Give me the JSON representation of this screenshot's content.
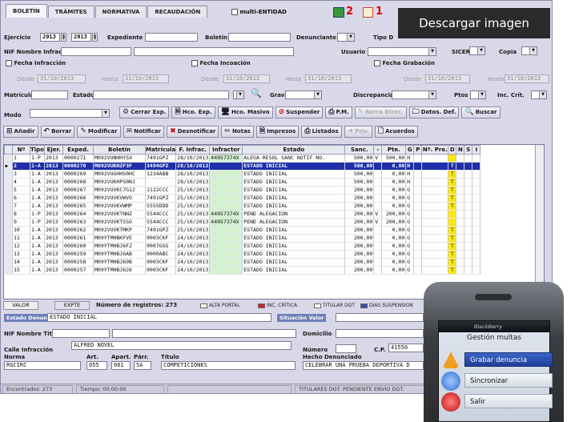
{
  "tabs": [
    "BOLETÍN",
    "TRÁMITES",
    "NORMATIVA",
    "RECAUDACIÓN"
  ],
  "multi_entidad": "multi-ENTIDAD",
  "badge_counts": [
    "2",
    "1"
  ],
  "overlay_text": "Descargar imagen",
  "filters": {
    "ejercicio_label": "Ejercicio",
    "ejercicio_from": "2013",
    "ejercicio_to": "2013",
    "expediente_label": "Expediente",
    "boletin_label": "Boletín",
    "denunciante_label": "Denunciante",
    "tipo_label": "Tipo D",
    "nif_label": "NIF Nombre Infractor",
    "usuario_label": "Usuario",
    "sicer_label": "SICER",
    "copia_label": "Copia",
    "fecha_infraccion": "Fecha Infracción",
    "fecha_incoacion": "Fecha Incoación",
    "fecha_grabacion": "Fecha Grabación",
    "desde": "Desde",
    "hasta": "Hasta",
    "date": "31/10/2013",
    "matricula_label": "Matrícula",
    "estado_label": "Estado",
    "grav_label": "Grav",
    "discrepancia_label": "Discrepancia",
    "ptos_label": "Ptos",
    "inc_crit_label": "Inc. Crít.",
    "modo_label": "Modo"
  },
  "toolbar1": [
    "Cerrar Exp.",
    "Hco. Exp.",
    "Hco. Masivo",
    "Suspender",
    "P.M.",
    "Borra Direc.",
    "Datos. Def.",
    "Buscar"
  ],
  "toolbar2": [
    "Añadir",
    "Borrar",
    "Modificar",
    "Notificar",
    "Desnotificar",
    "Notas",
    "Impresos",
    "Listados",
    "Priv.",
    "Acuerdos"
  ],
  "columns": [
    "Nº",
    "Tipo",
    "Ejer.",
    "Exped.",
    "Boletín",
    "Matrícula",
    "F. Infrac.",
    "Infractor",
    "Estado",
    "Sanc.",
    "-",
    "Pte.",
    "G",
    "P",
    "Nº. Pre.",
    "D",
    "N",
    "S",
    "I"
  ],
  "rows": [
    [
      "1",
      "1-P",
      "2013",
      "0000271",
      "M092VUNHHYSX",
      "7491GPZ",
      "28/10/2013",
      "44957374X",
      "ALEGA RESOL SANC NOTIF NO.",
      "500,00",
      "V",
      "500,00",
      "H",
      "",
      "",
      "",
      "",
      "",
      ""
    ],
    [
      "2",
      "1-A",
      "2013",
      "0000270",
      "M092VUKHZF3F",
      "3494GPZ",
      "28/10/2013",
      "",
      "ESTADO INICIAL",
      "500,00",
      "",
      "0,00",
      "H",
      "",
      "",
      "T",
      "",
      "",
      ""
    ],
    [
      "3",
      "1-A",
      "2013",
      "0000269",
      "M092VUGHHS0HC",
      "1234ABB",
      "28/10/2013",
      "",
      "ESTADO INICIAL",
      "500,00",
      "",
      "0,00",
      "H",
      "",
      "",
      "T",
      "",
      "",
      ""
    ],
    [
      "4",
      "1-A",
      "2013",
      "0000268",
      "M092VUKHPG0NJ",
      "",
      "28/10/2013",
      "",
      "ESTADO INICIAL",
      "500,00",
      "",
      "0,00",
      "H",
      "",
      "",
      "T",
      "",
      "",
      ""
    ],
    [
      "5",
      "1-A",
      "2013",
      "0000267",
      "M092VUVKC7G12",
      "1122CCC",
      "25/10/2013",
      "",
      "ESTADO INICIAL",
      "200,00",
      "",
      "0,00",
      "G",
      "",
      "",
      "T",
      "",
      "",
      ""
    ],
    [
      "6",
      "1-A",
      "2013",
      "0000266",
      "M092VUVKVWVO",
      "7491GPZ",
      "25/10/2013",
      "",
      "ESTADO INICIAL",
      "200,00",
      "",
      "0,00",
      "G",
      "",
      "",
      "T",
      "",
      "",
      ""
    ],
    [
      "7",
      "1-A",
      "2013",
      "0000265",
      "M092VUVKVWMP",
      "5555DDD",
      "25/10/2013",
      "",
      "ESTADO INICIAL",
      "200,00",
      "",
      "0,00",
      "G",
      "",
      "",
      "T",
      "",
      "",
      ""
    ],
    [
      "8",
      "1-P",
      "2013",
      "0000264",
      "M092VUVKTNNZ",
      "5544CCC",
      "25/10/2013",
      "44957374X",
      "PEND ALEGACION",
      "200,00",
      "V",
      "200,00",
      "G",
      "",
      "",
      "",
      "",
      "",
      ""
    ],
    [
      "9",
      "1-P",
      "2013",
      "0000263",
      "M092VUVKTSSO",
      "5544CCC",
      "25/10/2013",
      "44957374X",
      "PEND ALEGACION",
      "200,00",
      "V",
      "200,00",
      "G",
      "",
      "",
      "",
      "",
      "",
      ""
    ],
    [
      "10",
      "1-A",
      "2013",
      "0000262",
      "M092VUVKTMKP",
      "7491GPZ",
      "25/10/2013",
      "",
      "ESTADO INICIAL",
      "200,00",
      "",
      "0,00",
      "G",
      "",
      "",
      "T",
      "",
      "",
      ""
    ],
    [
      "11",
      "1-A",
      "2013",
      "0000261",
      "M09YTMHBKFVE",
      "0003CKF",
      "24/10/2013",
      "",
      "ESTADO INICIAL",
      "200,00",
      "",
      "0,00",
      "G",
      "",
      "",
      "T",
      "",
      "",
      ""
    ],
    [
      "12",
      "1-A",
      "2013",
      "0000260",
      "M09YTMHBJ6FZ",
      "0007GGG",
      "24/10/2013",
      "",
      "ESTADO INICIAL",
      "200,00",
      "",
      "0,00",
      "G",
      "",
      "",
      "T",
      "",
      "",
      ""
    ],
    [
      "13",
      "1-A",
      "2013",
      "0000259",
      "M09YTMHBJ6AB",
      "0000ABC",
      "24/10/2013",
      "",
      "ESTADO INICIAL",
      "200,00",
      "",
      "0,00",
      "G",
      "",
      "",
      "T",
      "",
      "",
      ""
    ],
    [
      "14",
      "1-A",
      "2013",
      "0000258",
      "M09YTMHBJ69B",
      "0003CKF",
      "24/10/2013",
      "",
      "ESTADO INICIAL",
      "200,00",
      "",
      "0,00",
      "G",
      "",
      "",
      "T",
      "",
      "",
      ""
    ],
    [
      "15",
      "1-A",
      "2013",
      "0000257",
      "M09YTMHBJ626",
      "0003CKF",
      "24/10/2013",
      "",
      "ESTADO INICIAL",
      "200,00",
      "",
      "0,00",
      "G",
      "",
      "",
      "T",
      "",
      "",
      ""
    ]
  ],
  "status": {
    "valor": "VALOR",
    "expte": "EXPTE",
    "registros": "Número de registros: 273",
    "alta_portal": "ALTA PORTAL",
    "inc_critica": "INC. CRÍTICA",
    "titular_dgt": "TITULAR DGT",
    "dias_suspension": "DIAS SUSPENSION"
  },
  "detail": {
    "estado_denuncia_label": "Estado Denuncia",
    "estado_denuncia": "ESTADO INICIAL",
    "situacion_label": "Situación Valor",
    "nif_titular_label": "NIF Nombre Titular",
    "domicilio_label": "Domicilio",
    "calle_label": "Calle Infracción",
    "calle": "ALFRED NOVEL",
    "numero_label": "Número",
    "cp_label": "C.P.",
    "cp": "41550",
    "norma_label": "Norma",
    "norma": "RGCIRC",
    "art_label": "Art.",
    "art": "055",
    "apart_label": "Apart.",
    "apart": "001",
    "parr_label": "Párr.",
    "parr": "5A",
    "titulo_label": "Título",
    "titulo": "COMPETICIONES",
    "hecho_label": "Hecho Denunciado",
    "hecho": "CELEBRAR UNA PRUEBA DEPORTIVA D"
  },
  "footer": {
    "encontrados": "Encontrados: 273",
    "tiempo": "Tiempo: 00:00:00",
    "titulares": "TITULARES DGT:  PENDIENTE ENVÍO DGT."
  },
  "phone": {
    "brand": "BlackBerry",
    "title": "Gestión multas",
    "items": [
      "Grabar denuncia",
      "Sincronizar",
      "Salir"
    ]
  }
}
